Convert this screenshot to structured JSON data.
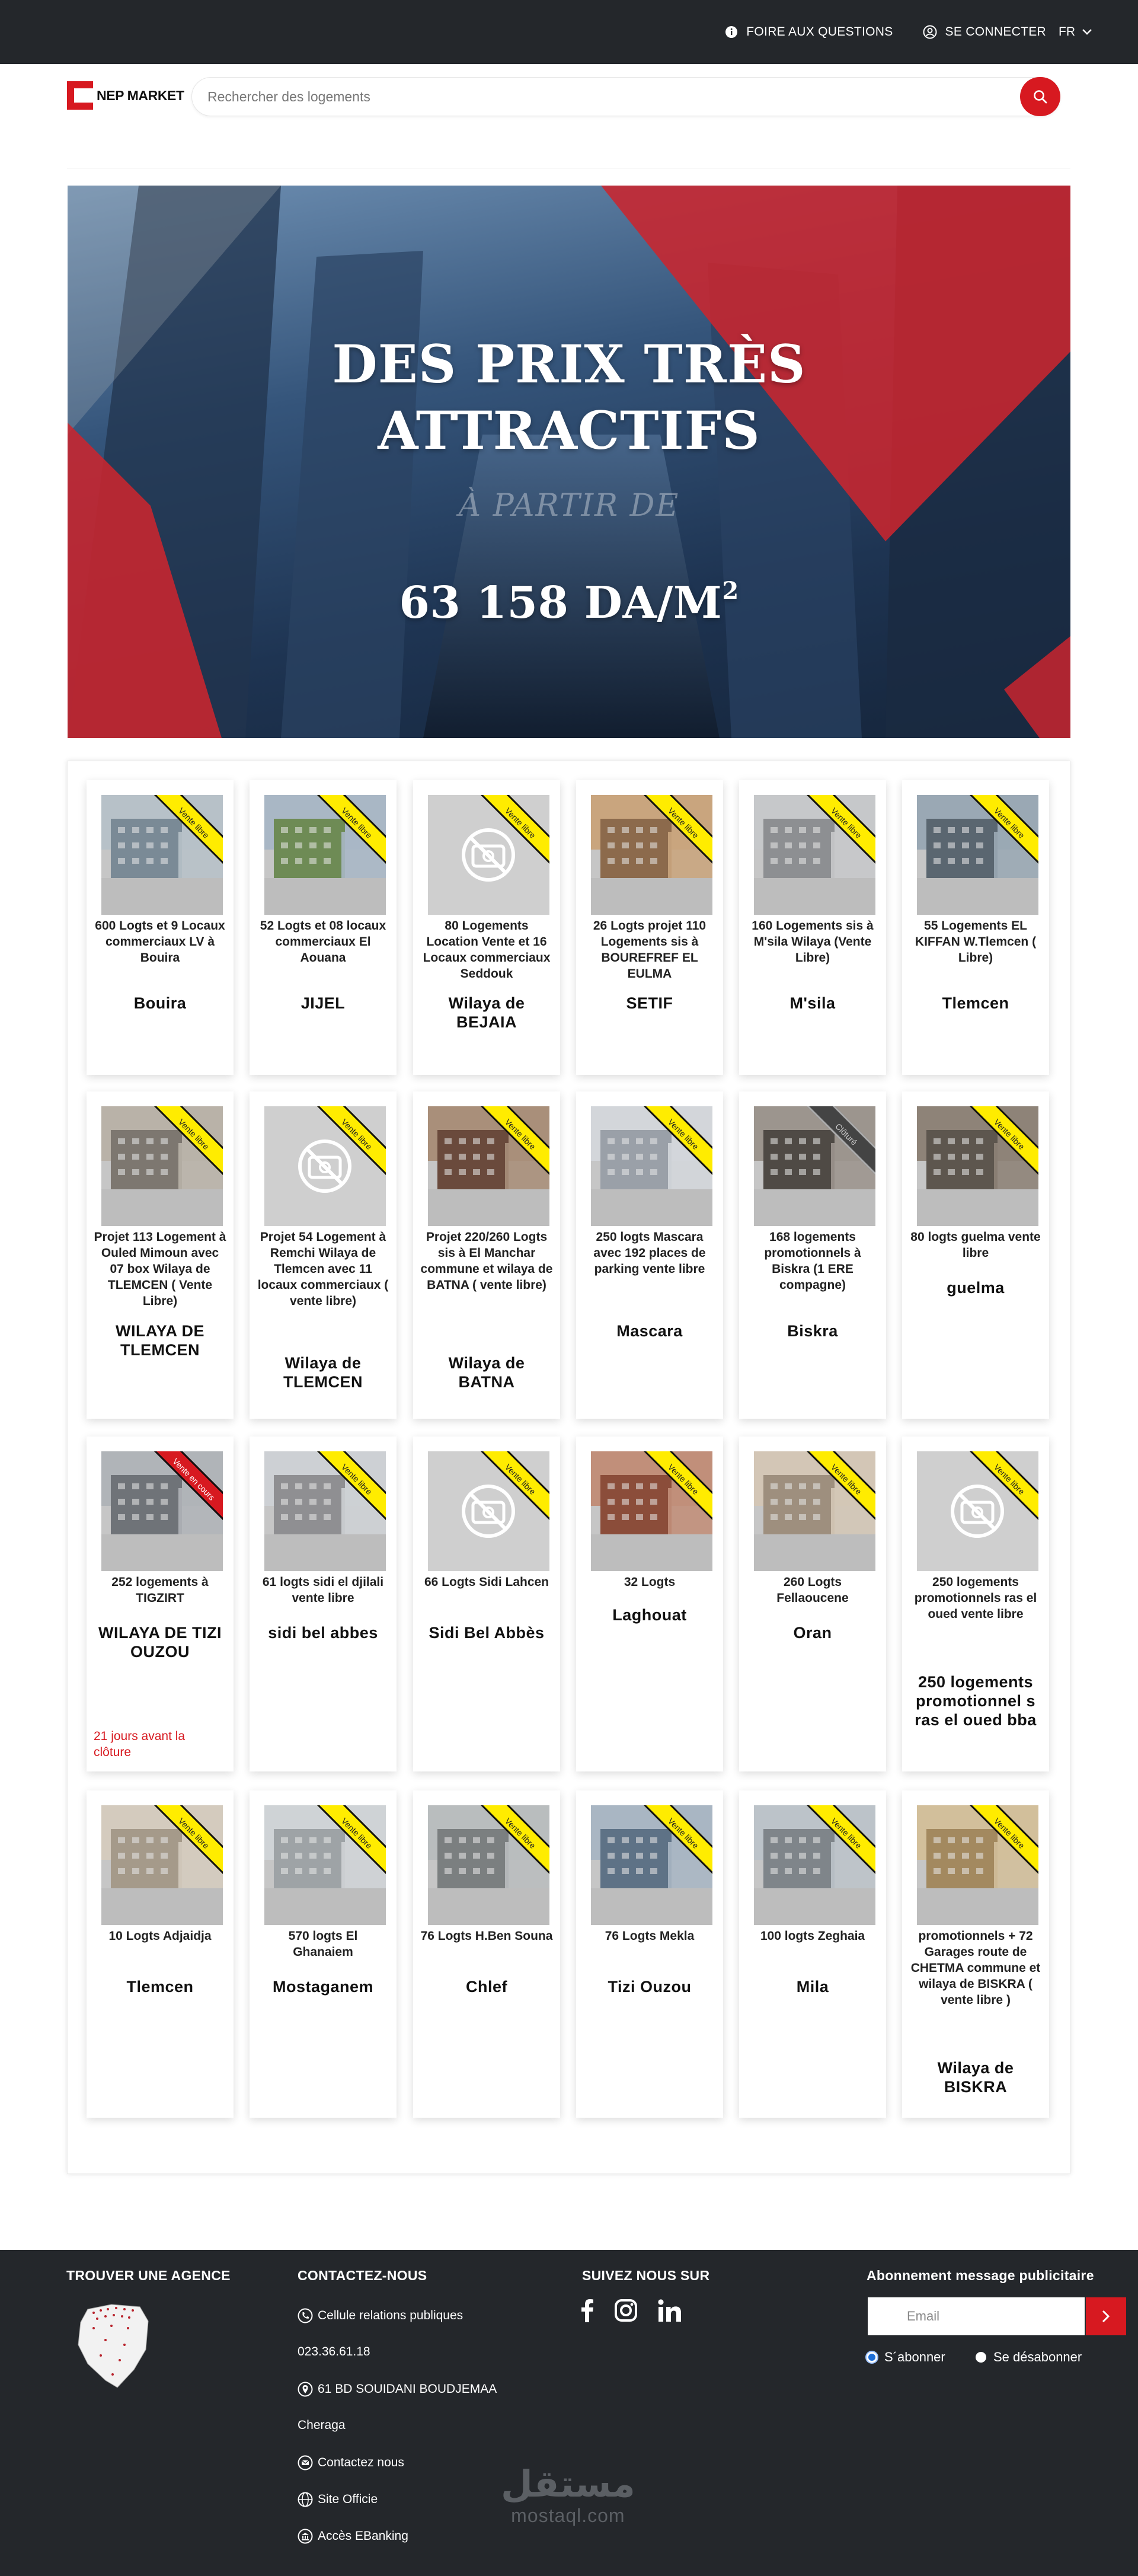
{
  "topbar": {
    "faq_label": "FOIRE AUX QUESTIONS",
    "login_label": "SE CONNECTER",
    "language": "FR",
    "icons": [
      "info-icon",
      "user-circle-icon",
      "chevron-down-icon"
    ]
  },
  "header": {
    "logo_text": "NEP MARKET",
    "search_placeholder": "Rechercher des logements",
    "colors": {
      "brand": "#d71920",
      "dark": "#24272b"
    }
  },
  "banner": {
    "headline_line1": "DES PRIX TRÈS",
    "headline_line2": "ATTRACTIFS",
    "subline": "À PARTIR DE",
    "price": "63 158 DA/M",
    "price_sup": "2"
  },
  "listings": [
    {
      "title": "600 Logts et 9 Locaux commerciaux LV à Bouira",
      "city": "Bouira",
      "status": "Vente libre",
      "image": "photo"
    },
    {
      "title": "52 Logts et 08 locaux commerciaux El Aouana",
      "city": "JIJEL",
      "status": "Vente libre",
      "image": "photo"
    },
    {
      "title": "80 Logements Location Vente et 16 Locaux commerciaux Seddouk",
      "city": "Wilaya de BEJAIA",
      "status": "Vente libre",
      "image": "no-photo"
    },
    {
      "title": "26 Logts projet 110 Logements sis à BOUREFREF EL EULMA",
      "city": "SETIF",
      "status": "Vente libre",
      "image": "photo"
    },
    {
      "title": "160 Logements sis à M'sila Wilaya (Vente Libre)",
      "city": "M'sila",
      "status": "Vente libre",
      "image": "photo"
    },
    {
      "title": "55 Logements EL KIFFAN W.Tlemcen ( Libre)",
      "city": "Tlemcen",
      "status": "Vente libre",
      "image": "photo"
    },
    {
      "title": "Projet 113 Logement à Ouled Mimoun avec 07 box Wilaya de TLEMCEN ( Vente Libre)",
      "city": "WILAYA DE TLEMCEN",
      "status": "Vente libre",
      "image": "photo"
    },
    {
      "title": "Projet 54 Logement à Remchi Wilaya de Tlemcen avec 11 locaux commerciaux ( vente libre)",
      "city": "Wilaya de TLEMCEN",
      "status": "Vente libre",
      "image": "no-photo"
    },
    {
      "title": "Projet 220/260 Logts sis à El Manchar commune et wilaya de BATNA ( vente libre)",
      "city": "Wilaya de BATNA",
      "status": "Vente libre",
      "image": "photo"
    },
    {
      "title": "250 logts Mascara avec 192 places de parking vente libre",
      "city": "Mascara",
      "status": "Vente libre",
      "image": "photo"
    },
    {
      "title": "168 logements promotionnels à Biskra (1 ERE compagne)",
      "city": "Biskra",
      "status": "Clôturé",
      "image": "photo"
    },
    {
      "title": "80 logts guelma vente libre",
      "city": "guelma",
      "status": "Vente libre",
      "image": "photo"
    },
    {
      "title": "252 logements à TIGZIRT",
      "city": "WILAYA DE TIZI OUZOU",
      "status": "Vente en cours",
      "image": "photo",
      "deadline": "21 jours avant la clôture"
    },
    {
      "title": "61 logts sidi el djilali vente libre",
      "city": "sidi bel abbes",
      "status": "Vente libre",
      "image": "photo"
    },
    {
      "title": "66 Logts Sidi Lahcen",
      "city": "Sidi Bel Abbès",
      "status": "Vente libre",
      "image": "no-photo"
    },
    {
      "title": "32 Logts",
      "city": "Laghouat",
      "status": "Vente libre",
      "image": "photo"
    },
    {
      "title": "260 Logts Fellaoucene",
      "city": "Oran",
      "status": "Vente libre",
      "image": "photo"
    },
    {
      "title": "250 logements promotionnels ras el oued vente libre",
      "city": "250 logements promotionnel s ras el oued bba",
      "status": "Vente libre",
      "image": "no-photo"
    },
    {
      "title": "10 Logts Adjaidja",
      "city": "Tlemcen",
      "status": "Vente libre",
      "image": "photo"
    },
    {
      "title": "570 logts El Ghanaiem",
      "city": "Mostaganem",
      "status": "Vente libre",
      "image": "photo"
    },
    {
      "title": "76 Logts H.Ben Souna",
      "city": "Chlef",
      "status": "Vente libre",
      "image": "photo"
    },
    {
      "title": "76 Logts Mekla",
      "city": "Tizi Ouzou",
      "status": "Vente libre",
      "image": "photo"
    },
    {
      "title": "100 logts Zeghaia",
      "city": "Mila",
      "status": "Vente libre",
      "image": "photo"
    },
    {
      "title": "promotionnels + 72 Garages route de CHETMA commune et wilaya de BISKRA ( vente libre )",
      "city": "Wilaya de BISKRA",
      "status": "Vente libre",
      "image": "photo"
    }
  ],
  "footer": {
    "agency_title": "TROUVER UNE AGENCE",
    "contact_title": "CONTACTEZ-NOUS",
    "contact": {
      "public_relations": "Cellule relations publiques",
      "phone": "023.36.61.18",
      "address": "61 BD SOUIDANI BOUDJEMAA",
      "address_city": "Cheraga",
      "contact_us": "Contactez nous",
      "official_site": "Site Officie",
      "ebanking": "Accès EBanking"
    },
    "follow_title": "SUIVEZ NOUS SUR",
    "social": [
      "facebook-icon",
      "instagram-icon",
      "linkedin-icon"
    ],
    "newsletter_title": "Abonnement message publicitaire",
    "email_placeholder": "Email",
    "subscribe_label": "S´abonner",
    "unsubscribe_label": "Se désabonner",
    "watermark_ar": "مستقل",
    "watermark_lat": "mostaql.com"
  }
}
